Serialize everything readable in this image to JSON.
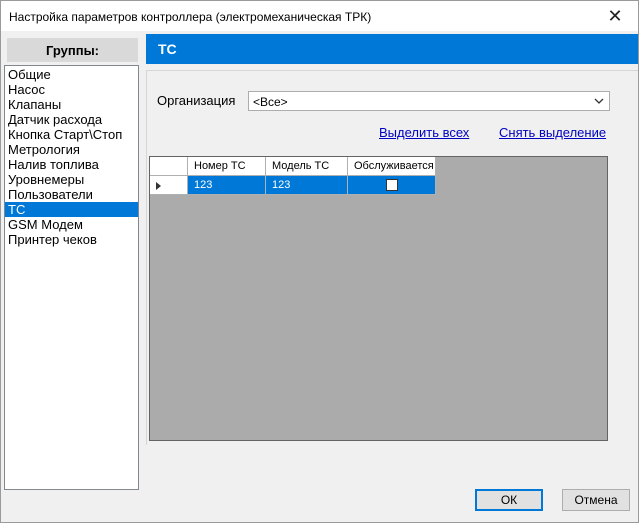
{
  "window": {
    "title": "Настройка параметров контроллера (электромеханическая ТРК)",
    "close_symbol": "✕"
  },
  "groups": {
    "header": "Группы:",
    "items": [
      "Общие",
      "Насос",
      "Клапаны",
      "Датчик расхода",
      "Кнопка Старт\\Стоп",
      "Метрология",
      "Налив топлива",
      "Уровнемеры",
      "Пользователи",
      "ТС",
      "GSM Модем",
      "Принтер чеков"
    ],
    "selected_index": 9
  },
  "section": {
    "title": "ТС"
  },
  "organization": {
    "label": "Организация",
    "value": "<Все>"
  },
  "links": {
    "select_all": "Выделить всех",
    "deselect": "Снять выделение"
  },
  "table": {
    "columns": [
      "Номер ТС",
      "Модель ТС",
      "Обслуживается"
    ],
    "rows": [
      {
        "number": "123",
        "model": "123",
        "serviced": false
      }
    ]
  },
  "buttons": {
    "ok": "ОК",
    "cancel": "Отмена"
  },
  "colors": {
    "accent": "#0078d7",
    "grid_background": "#ababab",
    "link": "#0000c0"
  }
}
